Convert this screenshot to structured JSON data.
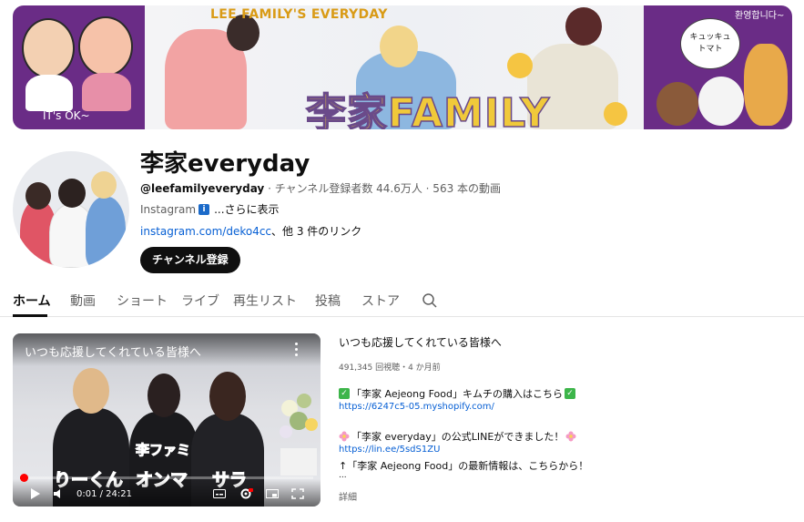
{
  "banner": {
    "kicker": "LEE FAMILY'S EVERYDAY",
    "wordmark": "李家FAMILY",
    "left_caption": "IT's OK~",
    "bubble_text": "キュッキュ トマト",
    "right_sign": "환영합니다~",
    "colors": {
      "panel": "#6a2c86",
      "wordmark": "#f0c93a",
      "kicker": "#d99b16"
    }
  },
  "channel": {
    "name": "李家everyday",
    "handle": "@leefamilyeveryday",
    "meta_rest": " · チャンネル登録者数 44.6万人 · 563 本の動画",
    "desc_label": "Instagram",
    "desc_badge": "i",
    "desc_more": "...さらに表示",
    "link_primary": "instagram.com/deko4cc",
    "link_rest": "、他 3 件のリンク",
    "subscribe_label": "チャンネル登録"
  },
  "tabs": [
    {
      "label": "ホーム",
      "active": true
    },
    {
      "label": "動画"
    },
    {
      "label": "ショート"
    },
    {
      "label": "ライブ"
    },
    {
      "label": "再生リスト"
    },
    {
      "label": "投稿"
    },
    {
      "label": "ストア"
    }
  ],
  "player": {
    "title": "いつも応援してくれている皆様へ",
    "time": "0:01 / 24:21",
    "progress_fraction": 0.0007,
    "name_labels": [
      "りーくん",
      "李ファミ",
      "オンマ",
      "サラ"
    ],
    "icons": [
      "play-icon",
      "volume-icon",
      "subtitles-icon",
      "settings-icon",
      "miniplayer-icon",
      "fullscreen-icon",
      "more-vert-icon"
    ],
    "hd_badge": "HD"
  },
  "video": {
    "title": "いつも応援してくれている皆様へ",
    "stats": "491,345 回視聴・4 か月前",
    "line1": "「李家 Aejeong Food」キムチの購入はこちら",
    "link1": "https://6247c5-05.myshopify.com/",
    "line2": "「李家 everyday」の公式LINEができました！",
    "link2": "https://lin.ee/5sdS1ZU",
    "line3": "↑「李家 Aejeong Food」の最新情報は、こちらから！",
    "ellipsis": "...",
    "details": "詳細"
  }
}
